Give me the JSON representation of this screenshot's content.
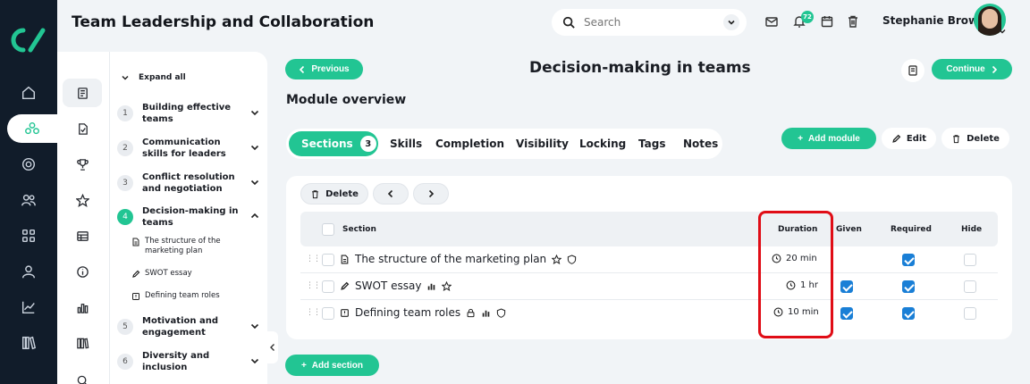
{
  "app": {
    "title": "Team Leadership and Collaboration"
  },
  "search": {
    "placeholder": "Search"
  },
  "header": {
    "notifications_count": "72",
    "user_name": "Stephanie Brown"
  },
  "rail": {
    "items": [
      "home-icon",
      "courses-icon",
      "target-icon",
      "users-icon",
      "grid-icon",
      "user-icon",
      "analytics-icon",
      "library-icon"
    ]
  },
  "outline": {
    "expand_all": "Expand all",
    "sections": [
      {
        "num": "1",
        "label": "Building effective teams"
      },
      {
        "num": "2",
        "label": "Communication skills for leaders"
      },
      {
        "num": "3",
        "label": "Conflict resolution and negotiation"
      },
      {
        "num": "4",
        "label": "Decision-making in teams"
      },
      {
        "num": "5",
        "label": "Motivation and engagement"
      },
      {
        "num": "6",
        "label": "Diversity and inclusion"
      }
    ],
    "sub_items": [
      "The structure of the marketing plan",
      "SWOT essay",
      "Defining team roles"
    ]
  },
  "nav": {
    "previous": "Previous",
    "continue": "Continue"
  },
  "page": {
    "title": "Decision-making in teams",
    "subtitle": "Module overview"
  },
  "tabs": [
    {
      "label": "Sections",
      "count": "3"
    },
    {
      "label": "Skills"
    },
    {
      "label": "Completion"
    },
    {
      "label": "Visibility"
    },
    {
      "label": "Locking"
    },
    {
      "label": "Tags"
    },
    {
      "label": "Notes"
    }
  ],
  "actions": {
    "add_module": "Add module",
    "edit": "Edit",
    "delete": "Delete"
  },
  "table": {
    "delete": "Delete",
    "headers": {
      "section": "Section",
      "duration": "Duration",
      "given": "Given",
      "required": "Required",
      "hide": "Hide"
    },
    "rows": [
      {
        "title": "The structure of the marketing plan",
        "duration": "20 min",
        "given": false,
        "required": true,
        "hide": false
      },
      {
        "title": "SWOT essay",
        "duration": "1 hr",
        "given": true,
        "required": true,
        "hide": false
      },
      {
        "title": "Defining team roles",
        "duration": "10 min",
        "given": true,
        "required": true,
        "hide": false
      }
    ]
  },
  "add_section": "Add section",
  "colors": {
    "accent": "#22c593",
    "nav_bg": "#111c2a",
    "highlight": "#e00d16",
    "checkbox": "#1a7fd6"
  }
}
